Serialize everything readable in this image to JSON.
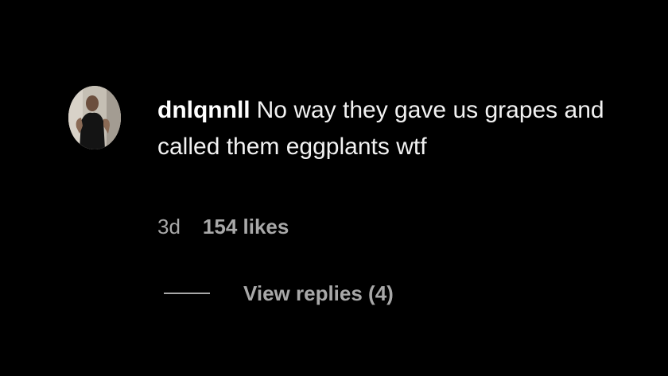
{
  "comment": {
    "username": "dnlqnnll",
    "text": "No way they gave us grapes and called them eggplants wtf",
    "time": "3d",
    "likes": "154 likes",
    "view_replies": "View replies (4)",
    "avatar": "avatar-photo"
  },
  "colors": {
    "background": "#000000",
    "primary_text": "#f5f5f5",
    "secondary_text": "#a8a8a8"
  }
}
